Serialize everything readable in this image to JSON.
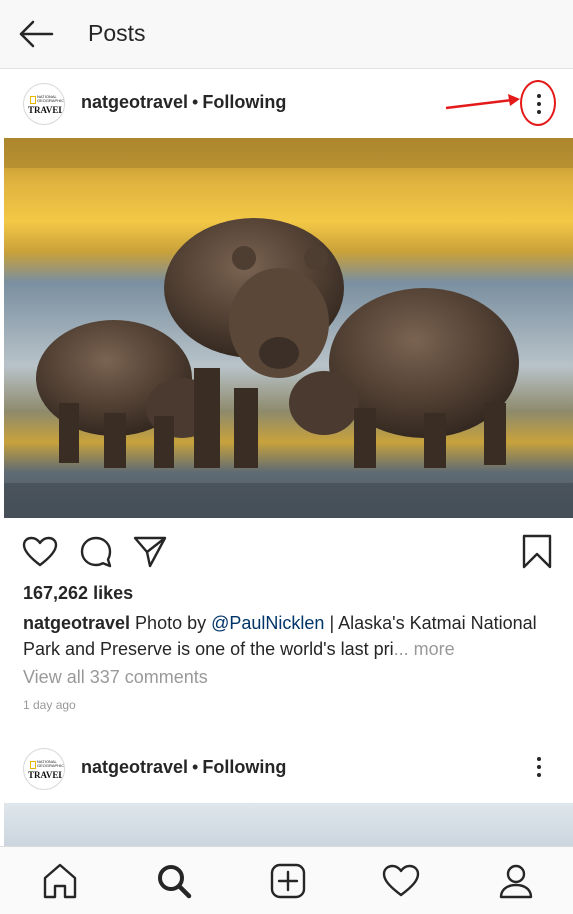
{
  "header": {
    "title": "Posts",
    "back_icon": "arrow-left-icon"
  },
  "posts": [
    {
      "username": "natgeotravel",
      "separator": "•",
      "following": "Following",
      "avatar": {
        "brand_small": "NATIONAL GEOGRAPHIC",
        "brand_large": "TRAVEL"
      },
      "more_icon": "more-vertical-icon",
      "likes": "167,262 likes",
      "caption": {
        "username": "natgeotravel",
        "text_before": " Photo by ",
        "mention": "@PaulNicklen",
        "text_after": " | Alaska's Katmai National Park and Preserve is one of the world's last pri",
        "ellipsis": "...",
        "more": "more"
      },
      "view_comments": "View all 337 comments",
      "time": "1 day ago"
    },
    {
      "username": "natgeotravel",
      "separator": "•",
      "following": "Following",
      "avatar": {
        "brand_small": "NATIONAL GEOGRAPHIC",
        "brand_large": "TRAVEL"
      },
      "more_icon": "more-vertical-icon"
    }
  ],
  "actions": {
    "like_icon": "heart-icon",
    "comment_icon": "comment-icon",
    "share_icon": "send-icon",
    "save_icon": "bookmark-icon"
  },
  "bottom_nav": [
    "home-icon",
    "search-icon",
    "add-post-icon",
    "activity-heart-icon",
    "profile-icon"
  ],
  "annotation": {
    "color": "#e41919"
  }
}
